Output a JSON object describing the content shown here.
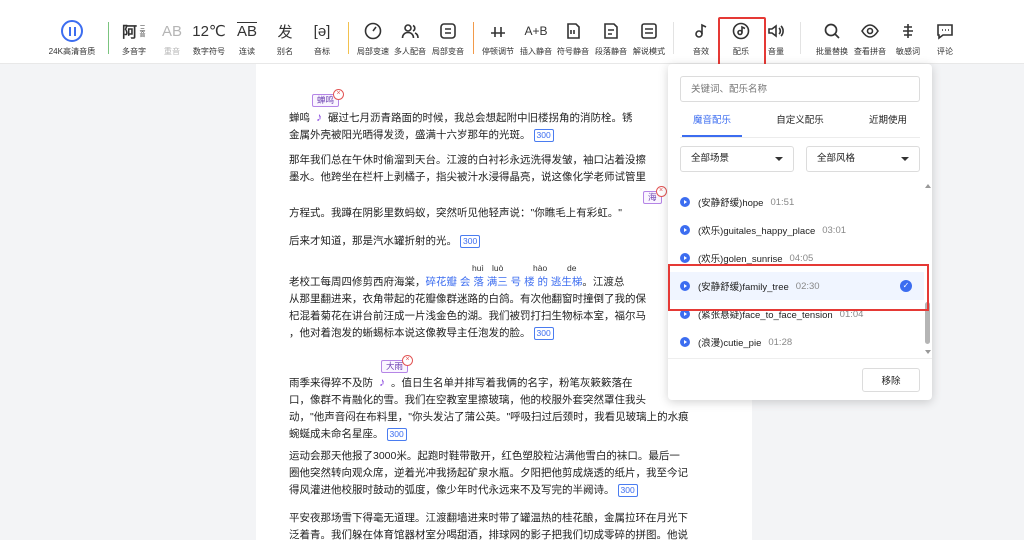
{
  "toolbar": {
    "quality_label": "24K高清音质",
    "items": [
      {
        "glyph": "阿",
        "sub": "三音",
        "label": "多音字"
      },
      {
        "glyph": "AB",
        "label": "重音"
      },
      {
        "glyph": "12℃",
        "label": "数字符号"
      },
      {
        "glyph": "AB",
        "label": "连读"
      },
      {
        "glyph": "发",
        "label": "别名"
      },
      {
        "glyph": "[ə]",
        "label": "音标"
      },
      {
        "label": "局部变速"
      },
      {
        "label": "多人配音"
      },
      {
        "label": "局部变音"
      },
      {
        "label": "停顿调节"
      },
      {
        "glyph": "A+B",
        "label": "插入静音"
      },
      {
        "label": "符号静音"
      },
      {
        "label": "段落静音"
      },
      {
        "label": "解说模式"
      },
      {
        "label": "音效"
      },
      {
        "label": "配乐"
      },
      {
        "label": "音量"
      },
      {
        "label": "批量替换"
      },
      {
        "label": "查看拼音"
      },
      {
        "label": "敏感词"
      },
      {
        "label": "评论"
      }
    ]
  },
  "document": {
    "tags": [
      "蝉鸣",
      "海",
      "大雨"
    ],
    "p1": {
      "a": "蝉鸣",
      "b": "碾过七月沥青路面的时候，我总会想起附中旧楼拐角的消防栓。锈",
      "c": "金属外壳被阳光晒得发烫，盛满十六岁那年的光斑。"
    },
    "p2": {
      "a": "那年我们总在午休时偷溜到天台。江渡的白衬衫永远洗得发皱，袖口沾着没擦",
      "b": "墨水。他跨坐在栏杆上剥橘子，指尖被汁水浸得晶亮，说这像化学老师试管里"
    },
    "p3": "方程式。我蹲在阴影里数蚂蚁，突然听见他轻声说：\"你瞧毛上有彩虹。\"",
    "p4": "后来才知道，那是汽水罐折射的光。",
    "pinyin": [
      "huì",
      "luò",
      "hào",
      "de"
    ],
    "p5": {
      "a": "老校工每周四修剪西府海棠，",
      "b": "碎花瓣 会 落 满三 号 楼 的 逃生梯",
      "c": "。江渡总",
      "d": "从那里翻进来，衣角带起的花瓣像群迷路的白鸽。有次他翻窗时撞倒了我的保",
      "e": "杞混着菊花在讲台前汪成一片浅金色的湖。我们被罚打扫生物标本室，福尔马",
      "f": "，他对着泡发的蜥蜴标本说这像教导主任泡发的脸。"
    },
    "p6": {
      "a": "雨季来得猝不及防",
      "b": "。值日生名单并排写着我俩的名字，粉笔灰簌簌落在",
      "c": "口，像群不肯融化的雪。我们在空教室里擦玻璃，他的校服外套突然罩住我头",
      "d": "动，\"他声音闷在布料里，\"你头发沾了蒲公英。\"呼吸扫过后颈时，我看见玻璃上的水痕",
      "e": "蜿蜒成未命名星座。"
    },
    "p7": {
      "a": "运动会那天他报了3000米。起跑时鞋带散开，红色塑胶粒沾满他雪白的袜口。最后一",
      "b": "圈他突然转向观众席，逆着光冲我扬起矿泉水瓶。夕阳把他剪成烧透的纸片，我至今记",
      "c": "得风灌进他校服时鼓动的弧度，像少年时代永远来不及写完的半阙诗。"
    },
    "p8": {
      "a": "平安夜那场雪下得毫无道理。江渡翻墙进来时带了罐温热的桂花酿，金属拉环在月光下",
      "b": "泛着青。我们躲在体育馆器材室分喝甜酒，排球网的影子把我们切成零碎的拼图。他说"
    },
    "pause": "300"
  },
  "panel": {
    "search_placeholder": "关键词、配乐名称",
    "tabs": [
      "魔音配乐",
      "自定义配乐",
      "近期使用"
    ],
    "filters": [
      "全部场景",
      "全部风格"
    ],
    "tracks": [
      {
        "name": "(安静舒缓)hope",
        "dur": "01:51"
      },
      {
        "name": "(欢乐)guitales_happy_place",
        "dur": "03:01"
      },
      {
        "name": "(欢乐)golen_sunrise",
        "dur": "04:05"
      },
      {
        "name": "(安静舒缓)family_tree",
        "dur": "02:30"
      },
      {
        "name": "(紧张悬疑)face_to_face_tension",
        "dur": "01:04"
      },
      {
        "name": "(浪漫)cutie_pie",
        "dur": "01:28"
      }
    ],
    "remove_label": "移除"
  }
}
